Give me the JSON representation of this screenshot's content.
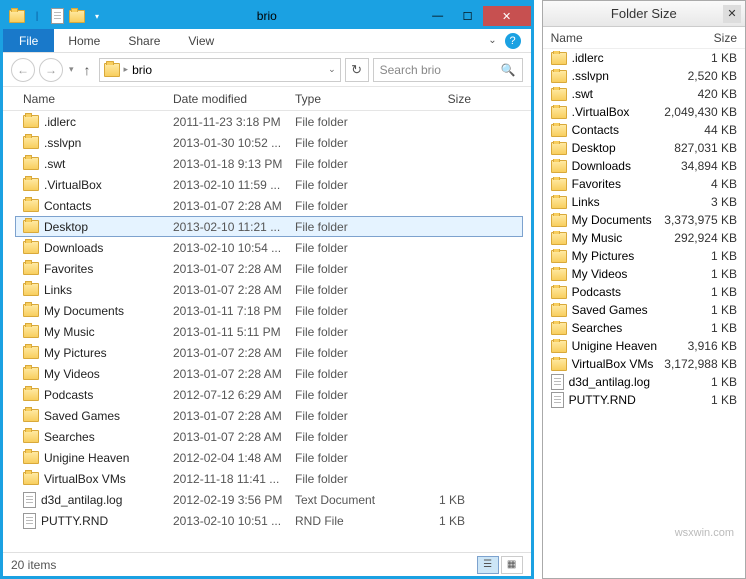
{
  "window": {
    "title": "brio",
    "file_tab": "File",
    "tabs": [
      "Home",
      "Share",
      "View"
    ]
  },
  "nav": {
    "breadcrumb": "brio",
    "search_placeholder": "Search brio"
  },
  "columns": {
    "name": "Name",
    "date": "Date modified",
    "type": "Type",
    "size": "Size"
  },
  "selected_index": 5,
  "files": [
    {
      "icon": "folder",
      "name": ".idlerc",
      "date": "2011-11-23 3:18 PM",
      "type": "File folder",
      "size": ""
    },
    {
      "icon": "folder",
      "name": ".sslvpn",
      "date": "2013-01-30 10:52 ...",
      "type": "File folder",
      "size": ""
    },
    {
      "icon": "folder",
      "name": ".swt",
      "date": "2013-01-18 9:13 PM",
      "type": "File folder",
      "size": ""
    },
    {
      "icon": "folder",
      "name": ".VirtualBox",
      "date": "2013-02-10 11:59 ...",
      "type": "File folder",
      "size": ""
    },
    {
      "icon": "folder",
      "name": "Contacts",
      "date": "2013-01-07 2:28 AM",
      "type": "File folder",
      "size": ""
    },
    {
      "icon": "folder",
      "name": "Desktop",
      "date": "2013-02-10 11:21 ...",
      "type": "File folder",
      "size": ""
    },
    {
      "icon": "folder",
      "name": "Downloads",
      "date": "2013-02-10 10:54 ...",
      "type": "File folder",
      "size": ""
    },
    {
      "icon": "folder",
      "name": "Favorites",
      "date": "2013-01-07 2:28 AM",
      "type": "File folder",
      "size": ""
    },
    {
      "icon": "folder",
      "name": "Links",
      "date": "2013-01-07 2:28 AM",
      "type": "File folder",
      "size": ""
    },
    {
      "icon": "folder",
      "name": "My Documents",
      "date": "2013-01-11 7:18 PM",
      "type": "File folder",
      "size": ""
    },
    {
      "icon": "folder",
      "name": "My Music",
      "date": "2013-01-11 5:11 PM",
      "type": "File folder",
      "size": ""
    },
    {
      "icon": "folder",
      "name": "My Pictures",
      "date": "2013-01-07 2:28 AM",
      "type": "File folder",
      "size": ""
    },
    {
      "icon": "folder",
      "name": "My Videos",
      "date": "2013-01-07 2:28 AM",
      "type": "File folder",
      "size": ""
    },
    {
      "icon": "folder",
      "name": "Podcasts",
      "date": "2012-07-12 6:29 AM",
      "type": "File folder",
      "size": ""
    },
    {
      "icon": "folder",
      "name": "Saved Games",
      "date": "2013-01-07 2:28 AM",
      "type": "File folder",
      "size": ""
    },
    {
      "icon": "folder",
      "name": "Searches",
      "date": "2013-01-07 2:28 AM",
      "type": "File folder",
      "size": ""
    },
    {
      "icon": "folder",
      "name": "Unigine Heaven",
      "date": "2012-02-04 1:48 AM",
      "type": "File folder",
      "size": ""
    },
    {
      "icon": "folder",
      "name": "VirtualBox VMs",
      "date": "2012-11-18 11:41 ...",
      "type": "File folder",
      "size": ""
    },
    {
      "icon": "file",
      "name": "d3d_antilag.log",
      "date": "2012-02-19 3:56 PM",
      "type": "Text Document",
      "size": "1 KB"
    },
    {
      "icon": "file",
      "name": "PUTTY.RND",
      "date": "2013-02-10 10:51 ...",
      "type": "RND File",
      "size": "1 KB"
    }
  ],
  "status": {
    "count": "20 items"
  },
  "side": {
    "title": "Folder Size",
    "columns": {
      "name": "Name",
      "size": "Size"
    },
    "items": [
      {
        "icon": "folder",
        "name": ".idlerc",
        "size": "1 KB"
      },
      {
        "icon": "folder",
        "name": ".sslvpn",
        "size": "2,520 KB"
      },
      {
        "icon": "folder",
        "name": ".swt",
        "size": "420 KB"
      },
      {
        "icon": "folder",
        "name": ".VirtualBox",
        "size": "2,049,430 KB"
      },
      {
        "icon": "folder",
        "name": "Contacts",
        "size": "44 KB"
      },
      {
        "icon": "folder",
        "name": "Desktop",
        "size": "827,031 KB"
      },
      {
        "icon": "folder",
        "name": "Downloads",
        "size": "34,894 KB"
      },
      {
        "icon": "folder",
        "name": "Favorites",
        "size": "4 KB"
      },
      {
        "icon": "folder",
        "name": "Links",
        "size": "3 KB"
      },
      {
        "icon": "folder",
        "name": "My Documents",
        "size": "3,373,975 KB"
      },
      {
        "icon": "folder",
        "name": "My Music",
        "size": "292,924 KB"
      },
      {
        "icon": "folder",
        "name": "My Pictures",
        "size": "1 KB"
      },
      {
        "icon": "folder",
        "name": "My Videos",
        "size": "1 KB"
      },
      {
        "icon": "folder",
        "name": "Podcasts",
        "size": "1 KB"
      },
      {
        "icon": "folder",
        "name": "Saved Games",
        "size": "1 KB"
      },
      {
        "icon": "folder",
        "name": "Searches",
        "size": "1 KB"
      },
      {
        "icon": "folder",
        "name": "Unigine Heaven",
        "size": "3,916 KB"
      },
      {
        "icon": "folder",
        "name": "VirtualBox VMs",
        "size": "3,172,988 KB"
      },
      {
        "icon": "file",
        "name": "d3d_antilag.log",
        "size": "1 KB"
      },
      {
        "icon": "file",
        "name": "PUTTY.RND",
        "size": "1 KB"
      }
    ]
  },
  "watermark": "wsxwin.com"
}
